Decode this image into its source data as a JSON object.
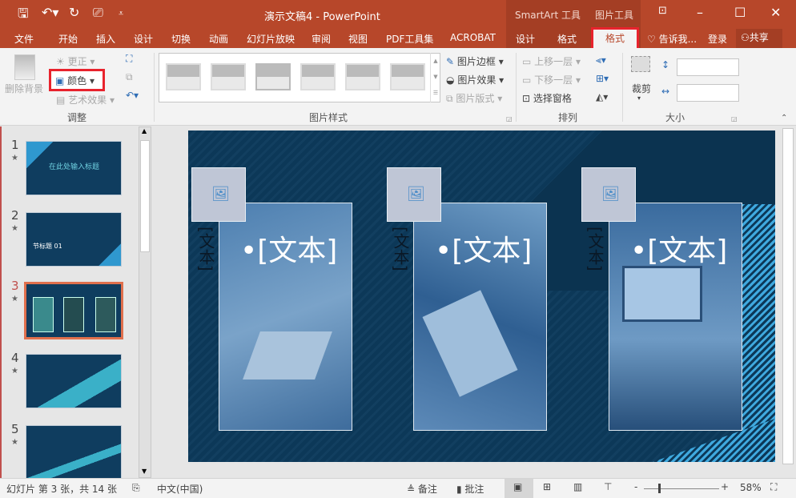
{
  "window": {
    "title": "演示文稿4 - PowerPoint",
    "context_groups": [
      "SmartArt 工具",
      "图片工具"
    ]
  },
  "tabs": [
    "文件",
    "开始",
    "插入",
    "设计",
    "切换",
    "动画",
    "幻灯片放映",
    "审阅",
    "视图",
    "PDF工具集",
    "ACROBAT",
    "设计",
    "格式",
    "格式"
  ],
  "tell_me": "告诉我...",
  "login": "登录",
  "share": "共享",
  "ribbon": {
    "adjust": {
      "remove_bg": "删除背景",
      "correct": "更正",
      "color": "颜色",
      "art_effect": "艺术效果",
      "group": "调整"
    },
    "styles": {
      "border": "图片边框",
      "effect": "图片效果",
      "layout": "图片版式",
      "group": "图片样式"
    },
    "arrange": {
      "forward": "上移一层",
      "backward": "下移一层",
      "selection": "选择窗格",
      "group": "排列"
    },
    "size": {
      "crop": "裁剪",
      "height": "",
      "width": "",
      "group": "大小"
    }
  },
  "slides": [
    {
      "num": "1",
      "title": "在此处输入标题"
    },
    {
      "num": "2",
      "title": "节标题 01"
    },
    {
      "num": "3",
      "title": ""
    },
    {
      "num": "4",
      "title": ""
    },
    {
      "num": "5",
      "title": ""
    }
  ],
  "current_slide": 3,
  "slide": {
    "items": [
      {
        "text": "•[文本]",
        "vertical": "[文本]"
      },
      {
        "text": "•[文本]",
        "vertical": "[文本]"
      },
      {
        "text": "•[文本]",
        "vertical": "[文本]"
      }
    ]
  },
  "status": {
    "slide_info": "幻灯片 第 3 张，共 14 张",
    "language": "中文(中国)",
    "notes": "备注",
    "comments": "批注",
    "zoom": "58%",
    "zoom_percent": 58
  },
  "colors": {
    "accent": "#b7472a",
    "highlight": "#e8232d",
    "slide_bg": "#0f3d5f"
  }
}
